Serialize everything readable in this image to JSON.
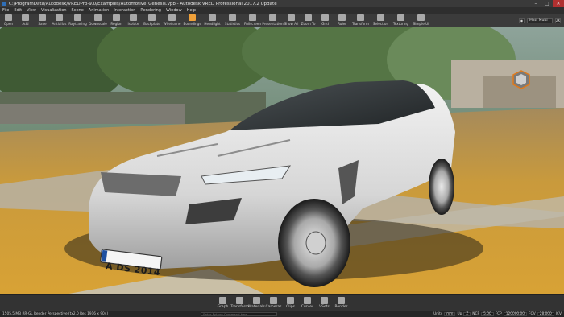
{
  "window": {
    "title": "C:/ProgramData/Autodesk/VREDPro-9.0/Examples/Automotive_Genesis.vpb - Autodesk VRED Professional 2017.2 Update",
    "minimize": "–",
    "maximize": "□",
    "close": "✕"
  },
  "menu": [
    "File",
    "Edit",
    "View",
    "Visualization",
    "Scene",
    "Animation",
    "Interaction",
    "Rendering",
    "Window",
    "Help"
  ],
  "toolbar": {
    "items": [
      {
        "label": "Open",
        "icon": "folder-icon"
      },
      {
        "label": "Add",
        "icon": "add-icon"
      },
      {
        "label": "Save",
        "icon": "save-icon"
      },
      {
        "label": "Antialias",
        "icon": "antialias-icon"
      },
      {
        "label": "Raytracing",
        "icon": "raytracing-icon"
      },
      {
        "label": "Downscale",
        "icon": "downscale-icon"
      },
      {
        "label": "Region",
        "icon": "region-icon"
      },
      {
        "label": "Isolate",
        "icon": "isolate-icon"
      },
      {
        "label": "Backplate",
        "icon": "backplate-icon"
      },
      {
        "label": "Wireframe",
        "icon": "wireframe-icon"
      },
      {
        "label": "Boundings",
        "icon": "boundings-icon"
      },
      {
        "label": "Headlight",
        "icon": "headlight-icon"
      },
      {
        "label": "Statistics",
        "icon": "statistics-icon"
      },
      {
        "label": "Fullscreen",
        "icon": "fullscreen-icon"
      },
      {
        "label": "Presentation",
        "icon": "presentation-icon"
      },
      {
        "label": "Show All",
        "icon": "show-all-icon"
      },
      {
        "label": "Zoom To",
        "icon": "zoom-to-icon"
      },
      {
        "label": "Grid",
        "icon": "grid-icon"
      },
      {
        "label": "Ruler",
        "icon": "ruler-icon"
      },
      {
        "label": "Transform",
        "icon": "transform-icon"
      },
      {
        "label": "Selection",
        "icon": "selection-icon"
      },
      {
        "label": "Texturing",
        "icon": "texturing-icon"
      },
      {
        "label": "Simple UI",
        "icon": "simple-ui-icon"
      }
    ],
    "camera_combo": "Matt Multi",
    "fov_button": "2K"
  },
  "viewport": {
    "plate": "A DS 2014"
  },
  "bottom_toolbar": [
    {
      "label": "Graph",
      "icon": "graph-icon"
    },
    {
      "label": "Transform",
      "icon": "transform-icon"
    },
    {
      "label": "Materials",
      "icon": "materials-icon"
    },
    {
      "label": "Cameras",
      "icon": "cameras-icon"
    },
    {
      "label": "Clips",
      "icon": "clips-icon"
    },
    {
      "label": "Curves",
      "icon": "curves-icon"
    },
    {
      "label": "VSets",
      "icon": "vsets-icon"
    },
    {
      "label": "Render",
      "icon": "render-icon"
    }
  ],
  "status": {
    "memory": "1505.5 MB",
    "mode": "RR-GL",
    "render_info": "Render Perspective (tx2.0 Res 1916 x 904)",
    "command_placeholder": "Enter Python Command here...",
    "units_label": "Units",
    "units_value": "mm",
    "up_label": "Up",
    "up_value": "Z",
    "ncp_label": "NCP",
    "ncp_value": "5.00",
    "fcp_label": "FCP",
    "fcp_value": "120000.00",
    "fov_label": "FOV",
    "fov_value": "28.000",
    "ich_label": "ICV"
  }
}
